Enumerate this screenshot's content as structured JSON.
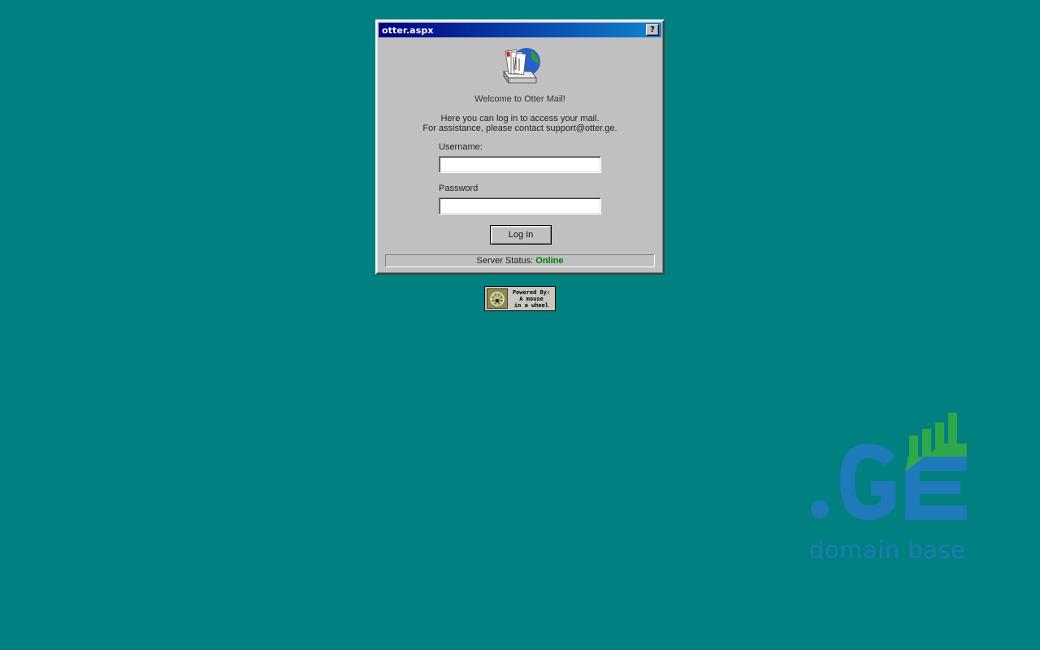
{
  "window": {
    "title": "otter.aspx",
    "help_label": "?"
  },
  "login": {
    "welcome": "Welcome to Otter Mail!",
    "intro_line1": "Here you can log in to access your mail.",
    "intro_line2": "For assistance, please contact support@otter.ge.",
    "username_label": "Username:",
    "username_value": "",
    "password_label": "Password",
    "password_value": "",
    "login_button": "Log In"
  },
  "status": {
    "prefix": "Server Status:",
    "value": "Online",
    "value_color": "#008000"
  },
  "badge": {
    "line1": "Powered By:",
    "line2": "A mouse",
    "line3": "in a wheel"
  },
  "logo": {
    "mark": ".GE",
    "tagline": "domain base",
    "brand_blue": "#1e7ab8",
    "brand_green": "#2ea84a"
  },
  "colors": {
    "desktop": "#008080",
    "window_face": "#c0c0c0",
    "titlebar_start": "#000080",
    "titlebar_end": "#1084d0"
  }
}
